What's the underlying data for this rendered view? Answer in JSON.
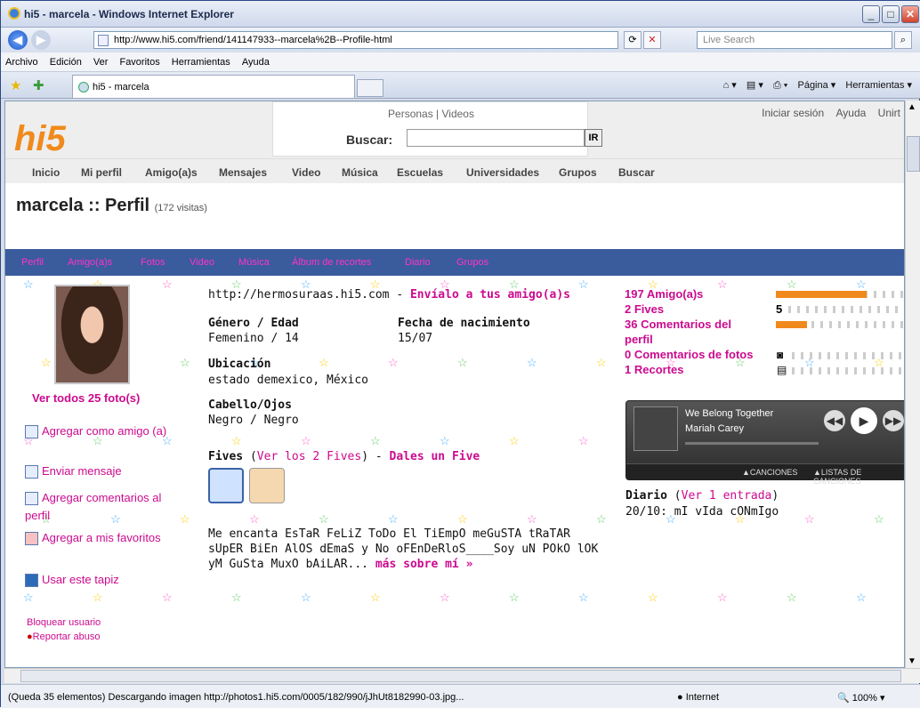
{
  "window": {
    "title": "hi5 - marcela - Windows Internet Explorer"
  },
  "address": {
    "url": "http://www.hi5.com/friend/141147933--marcela%2B--Profile-html",
    "search_placeholder": "Live Search"
  },
  "menu": [
    "Archivo",
    "Edición",
    "Ver",
    "Favoritos",
    "Herramientas",
    "Ayuda"
  ],
  "tab": {
    "label": "hi5 - marcela"
  },
  "commands": [
    "Página ▾",
    "Herramientas ▾"
  ],
  "site": {
    "logo": "hi5",
    "search_tabs": "Personas | Videos",
    "search_label": "Buscar:",
    "search_button": "IR",
    "top_links": [
      "Iniciar sesión",
      "Ayuda",
      "Unirt"
    ],
    "nav": [
      "Inicio",
      "Mi perfil",
      "Amigo(a)s",
      "Mensajes",
      "Video",
      "Música",
      "Escuelas",
      "Universidades",
      "Grupos",
      "Buscar"
    ]
  },
  "profile": {
    "title": "marcela :: Perfil",
    "visits": "(172 visitas)",
    "tabs": [
      "Perfil",
      "Amigo(a)s",
      "Fotos",
      "Video",
      "Música",
      "Álbum de recortes",
      "Diario",
      "Grupos"
    ],
    "photos_link": "Ver todos 25 foto(s)",
    "actions": [
      "Agregar como amigo (a)",
      "Enviar mensaje",
      "Agregar comentarios al perfil",
      "Agregar a mis favoritos",
      "Usar este tapiz"
    ],
    "block": "Bloquear usuario",
    "report": "Reportar abuso",
    "url": "http://hermosuraas.hi5.com",
    "send_link": "Envíalo a tus amigo(a)s",
    "gender_label": "Género / Edad",
    "gender_value": "Femenino / 14",
    "birth_label": "Fecha de nacimiento",
    "birth_value": "15/07",
    "location_label": "Ubicación",
    "location_value": "estado demexico, México",
    "hair_label": "Cabello/Ojos",
    "hair_value": "Negro / Negro",
    "fives_label": "Fives",
    "fives_link": "Ver los 2 Fives",
    "fives_give": "Dales un Five",
    "about_lines": [
      "Me encanta EsTaR FeLiZ ToDo El TiEmpO meGuSTA tRaTAR",
      "sUpER BiEn AlOS dEmaS y No oFEnDeRloS____Soy uN POkO lOK",
      "yM GuSta MuxO bAiLAR..."
    ],
    "about_more": "más sobre mí »",
    "stats": [
      "197 Amigo(a)s",
      "2 Fives",
      "36 Comentarios del perfil",
      "0 Comentarios de fotos",
      "1 Recortes"
    ],
    "stat_five": "5",
    "player": {
      "song": "We Belong Together",
      "artist": "Mariah Carey",
      "tab1": "▲CANCIONES",
      "tab2": "▲LISTAS DE CANCIONES"
    },
    "diary_label": "Diario",
    "diary_link": "Ver 1 entrada",
    "diary_entry": "20/10: mI vIda cONmIgo"
  },
  "status": {
    "message": "(Queda 35 elementos) Descargando imagen http://photos1.hi5.com/0005/182/990/jJhUt8182990-03.jpg...",
    "zone": "Internet",
    "zoom": "100%"
  }
}
